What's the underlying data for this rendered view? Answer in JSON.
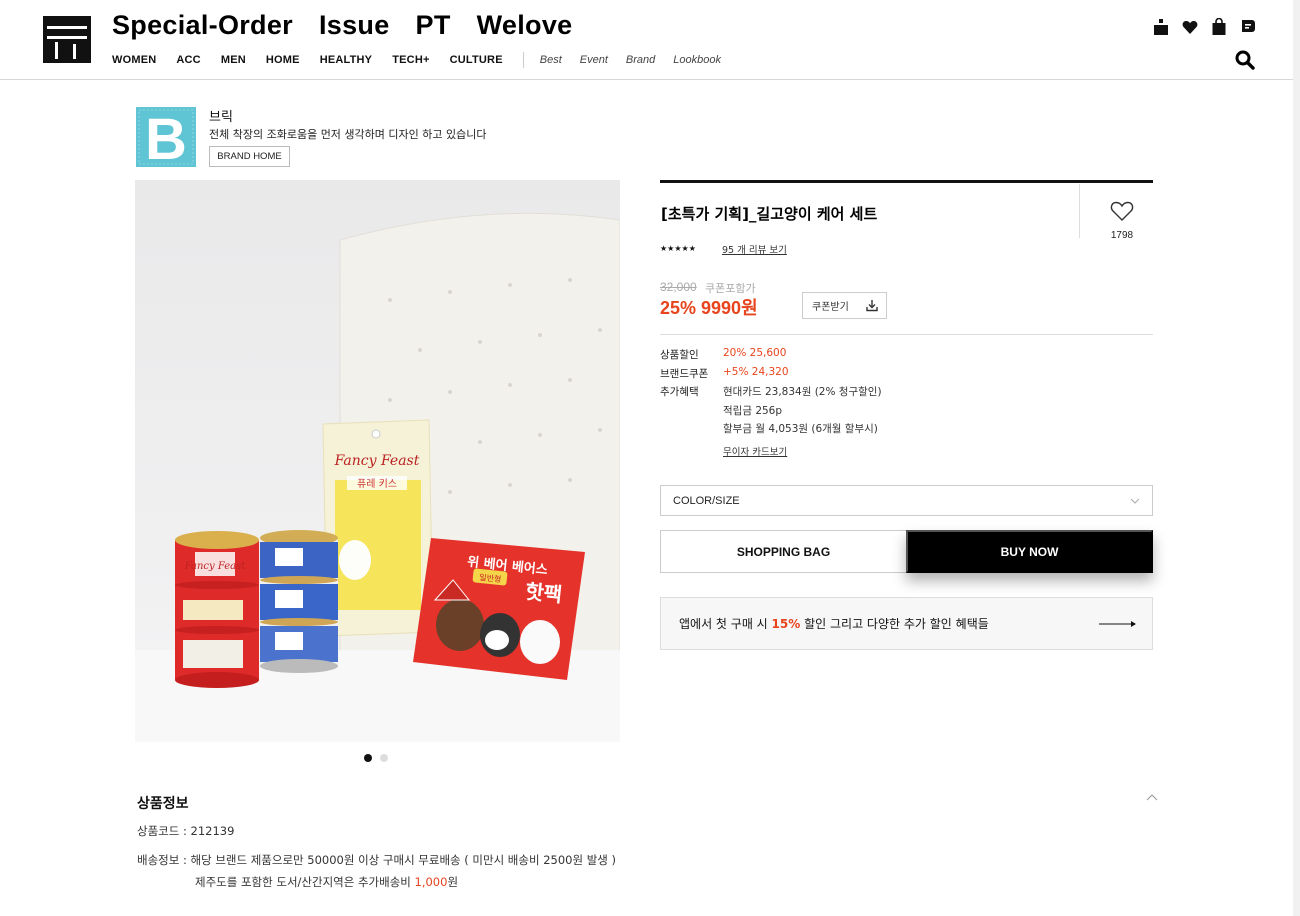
{
  "header": {
    "top_links": [
      "Special-Order",
      "Issue",
      "PT",
      "Welove"
    ],
    "categories": [
      "WOMEN",
      "ACC",
      "MEN",
      "HOME",
      "HEALTHY",
      "TECH+",
      "CULTURE"
    ],
    "sub_links": [
      "Best",
      "Event",
      "Brand",
      "Lookbook"
    ],
    "icons": [
      "user-icon",
      "heart-icon",
      "shopping-bag-icon",
      "chat-icon",
      "search-icon"
    ]
  },
  "brand": {
    "logo_letter": "B",
    "name": "브릭",
    "description": "전체 착장의 조화로움을 먼저 생각하며 디자인 하고 있습니다",
    "home_label": "BRAND HOME"
  },
  "product": {
    "title": "[초특가 기획]_길고양이 케어 세트",
    "wish_count": "1798",
    "rating": 5,
    "stars": "★★★★★",
    "review_link": "95 개 리뷰 보기",
    "original_price": "32,000",
    "coupon_price_label": "쿠폰포함가",
    "final_price": "25% 9990원",
    "coupon_button": "쿠폰받기",
    "details": {
      "discount_label": "상품할인",
      "discount_value": "20% 25,600",
      "brand_coupon_label": "브랜드쿠폰",
      "brand_coupon_value": "+5% 24,320",
      "benefit_label": "추가혜택",
      "benefit_card": "현대카드 23,834원 (2% 청구할인)",
      "benefit_points": "적립금 256p",
      "benefit_installment": "할부금 월 4,053원 (6개월 할부시)",
      "card_link": "무이자 카드보기"
    },
    "option_select": "COLOR/SIZE",
    "bag_button": "SHOPPING BAG",
    "buy_button": "BUY NOW",
    "app_banner": {
      "prefix": "앱에서 첫 구매 시 ",
      "percent": "15%",
      "suffix": " 할인 그리고 다양한 추가 할인 혜택들"
    },
    "carousel": {
      "count": 2,
      "active": 0
    }
  },
  "info": {
    "title": "상품정보",
    "code": "상품코드 : 212139",
    "shipping_line1": "배송정보 : 해당 브랜드 제품으로만 50000원 이상 구매시 무료배송 ( 미만시 배송비 2500원 발생 )",
    "shipping_line2_prefix": "제주도를 포함한 도서/산간지역은 추가배송비 ",
    "shipping_line2_amount": "1,000",
    "shipping_line2_suffix": "원"
  },
  "colors": {
    "accent": "#e8441d",
    "brand_logo_bg": "#5fc4d3",
    "button_dark": "#000000",
    "banner_bg": "#f7f7f7"
  },
  "product_image_text": {
    "packet_brand": "Fancy Feast",
    "packet_label": "퓨레 키스",
    "pack_title": "위 베어 베어스",
    "pack_sub": "핫팩",
    "pack_badge": "일반형",
    "can_brand": "Fancy Feast"
  }
}
